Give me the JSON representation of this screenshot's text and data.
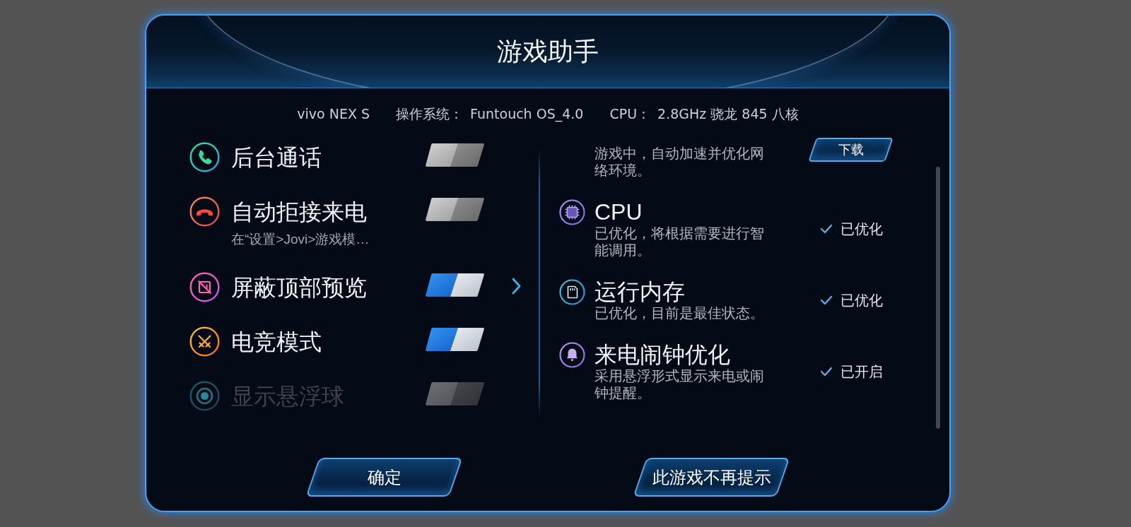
{
  "dialog": {
    "title": "游戏助手"
  },
  "device_info": {
    "model": "vivo NEX S",
    "specs": [
      {
        "label": "操作系统：",
        "value": "Funtouch OS_4.0"
      },
      {
        "label": "CPU：",
        "value": "2.8GHz 骁龙 845 八核"
      }
    ]
  },
  "settings": [
    {
      "label": "后台通话",
      "on": false,
      "disabled": false,
      "has_detail": false
    },
    {
      "label": "自动拒接来电",
      "hint": "在“设置>Jovi>游戏模…",
      "on": false,
      "disabled": false,
      "has_detail": false
    },
    {
      "label": "屏蔽顶部预览",
      "on": true,
      "disabled": false,
      "has_detail": true
    },
    {
      "label": "电竞模式",
      "on": true,
      "disabled": false,
      "has_detail": false
    },
    {
      "label": "显示悬浮球",
      "on": false,
      "disabled": true,
      "has_detail": false
    }
  ],
  "features": [
    {
      "kind": "action",
      "description": "游戏中，自动加速并优化网络环境。",
      "button": "下载"
    },
    {
      "kind": "status",
      "title": "CPU",
      "description": "已优化，将根据需要进行智能调用。",
      "status": "已优化"
    },
    {
      "kind": "status",
      "title": "运行内存",
      "description": "已优化，目前是最佳状态。",
      "status": "已优化"
    },
    {
      "kind": "status",
      "title": "来电闹钟优化",
      "description": "采用悬浮形式显示来电或闹钟提醒。",
      "status": "已开启"
    }
  ],
  "buttons": [
    {
      "label": "确定"
    },
    {
      "label": "此游戏不再提示"
    }
  ]
}
